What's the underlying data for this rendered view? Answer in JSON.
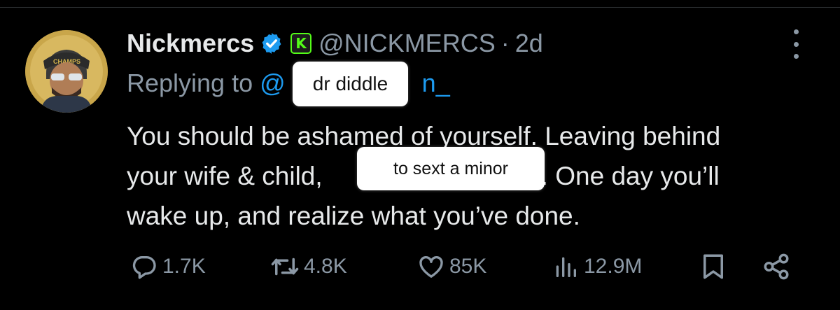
{
  "tweet": {
    "display_name": "Nickmercs",
    "handle": "@NICKMERCS",
    "separator": "·",
    "time": "2d",
    "replying_prefix": "Replying to",
    "replying_mention_start": "@",
    "replying_mention_end": "n_",
    "text_line1": "You should be ashamed of yourself. Leaving behind",
    "text_line2a": "your wife & child,",
    "text_line2b": ". One day you’ll",
    "text_line3": "wake up, and realize what you’ve done.",
    "avatar_cap_text": "CHAMPS"
  },
  "stickers": {
    "sticker1": "dr diddle",
    "sticker2": "to sext a minor"
  },
  "actions": {
    "replies": "1.7K",
    "reposts": "4.8K",
    "likes": "85K",
    "views": "12.9M"
  },
  "colors": {
    "background": "#000000",
    "text": "#e7e9ea",
    "muted": "#8b98a5",
    "accent": "#1d9bf0",
    "kick_green": "#53fc18"
  },
  "icons": [
    "verified-badge-icon",
    "kick-icon",
    "more-icon",
    "reply-icon",
    "repost-icon",
    "like-icon",
    "views-icon",
    "bookmark-icon",
    "share-icon"
  ]
}
